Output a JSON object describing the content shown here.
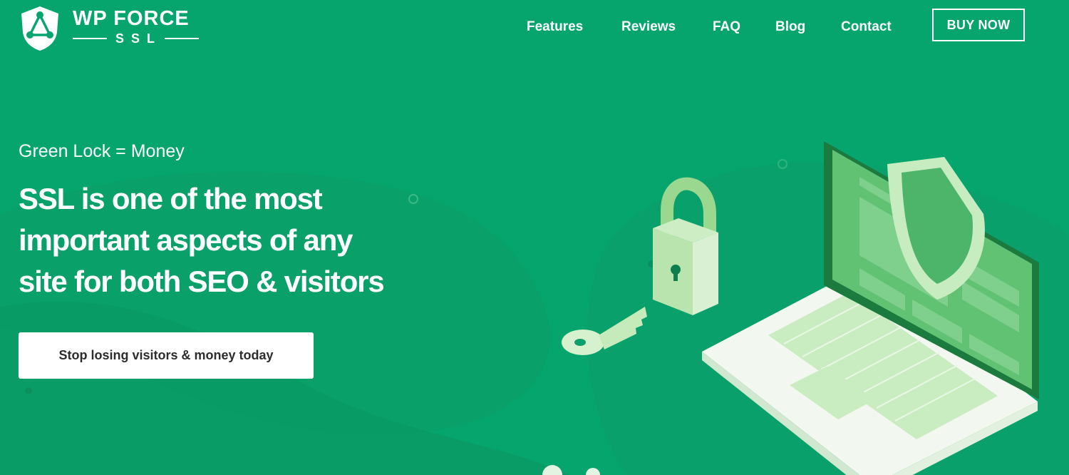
{
  "brand": {
    "name": "WP FORCE",
    "sub": "SSL"
  },
  "nav": {
    "items": [
      {
        "label": "Features"
      },
      {
        "label": "Reviews"
      },
      {
        "label": "FAQ"
      },
      {
        "label": "Blog"
      },
      {
        "label": "Contact"
      }
    ],
    "buy_label": "BUY NOW"
  },
  "hero": {
    "eyebrow": "Green Lock = Money",
    "headline_lines": [
      "SSL is one of the most",
      "important aspects of any",
      "site for both SEO & visitors"
    ],
    "cta_label": "Stop losing visitors & money today"
  },
  "colors": {
    "background": "#05a56d",
    "background_wave": "#0a9c67",
    "accent_light": "#a8e6a3",
    "button_text": "#2d2d2d"
  },
  "icons": [
    "logo-shield-icon",
    "padlock-icon",
    "key-icon",
    "laptop-shield-icon",
    "network-nodes-icon"
  ]
}
